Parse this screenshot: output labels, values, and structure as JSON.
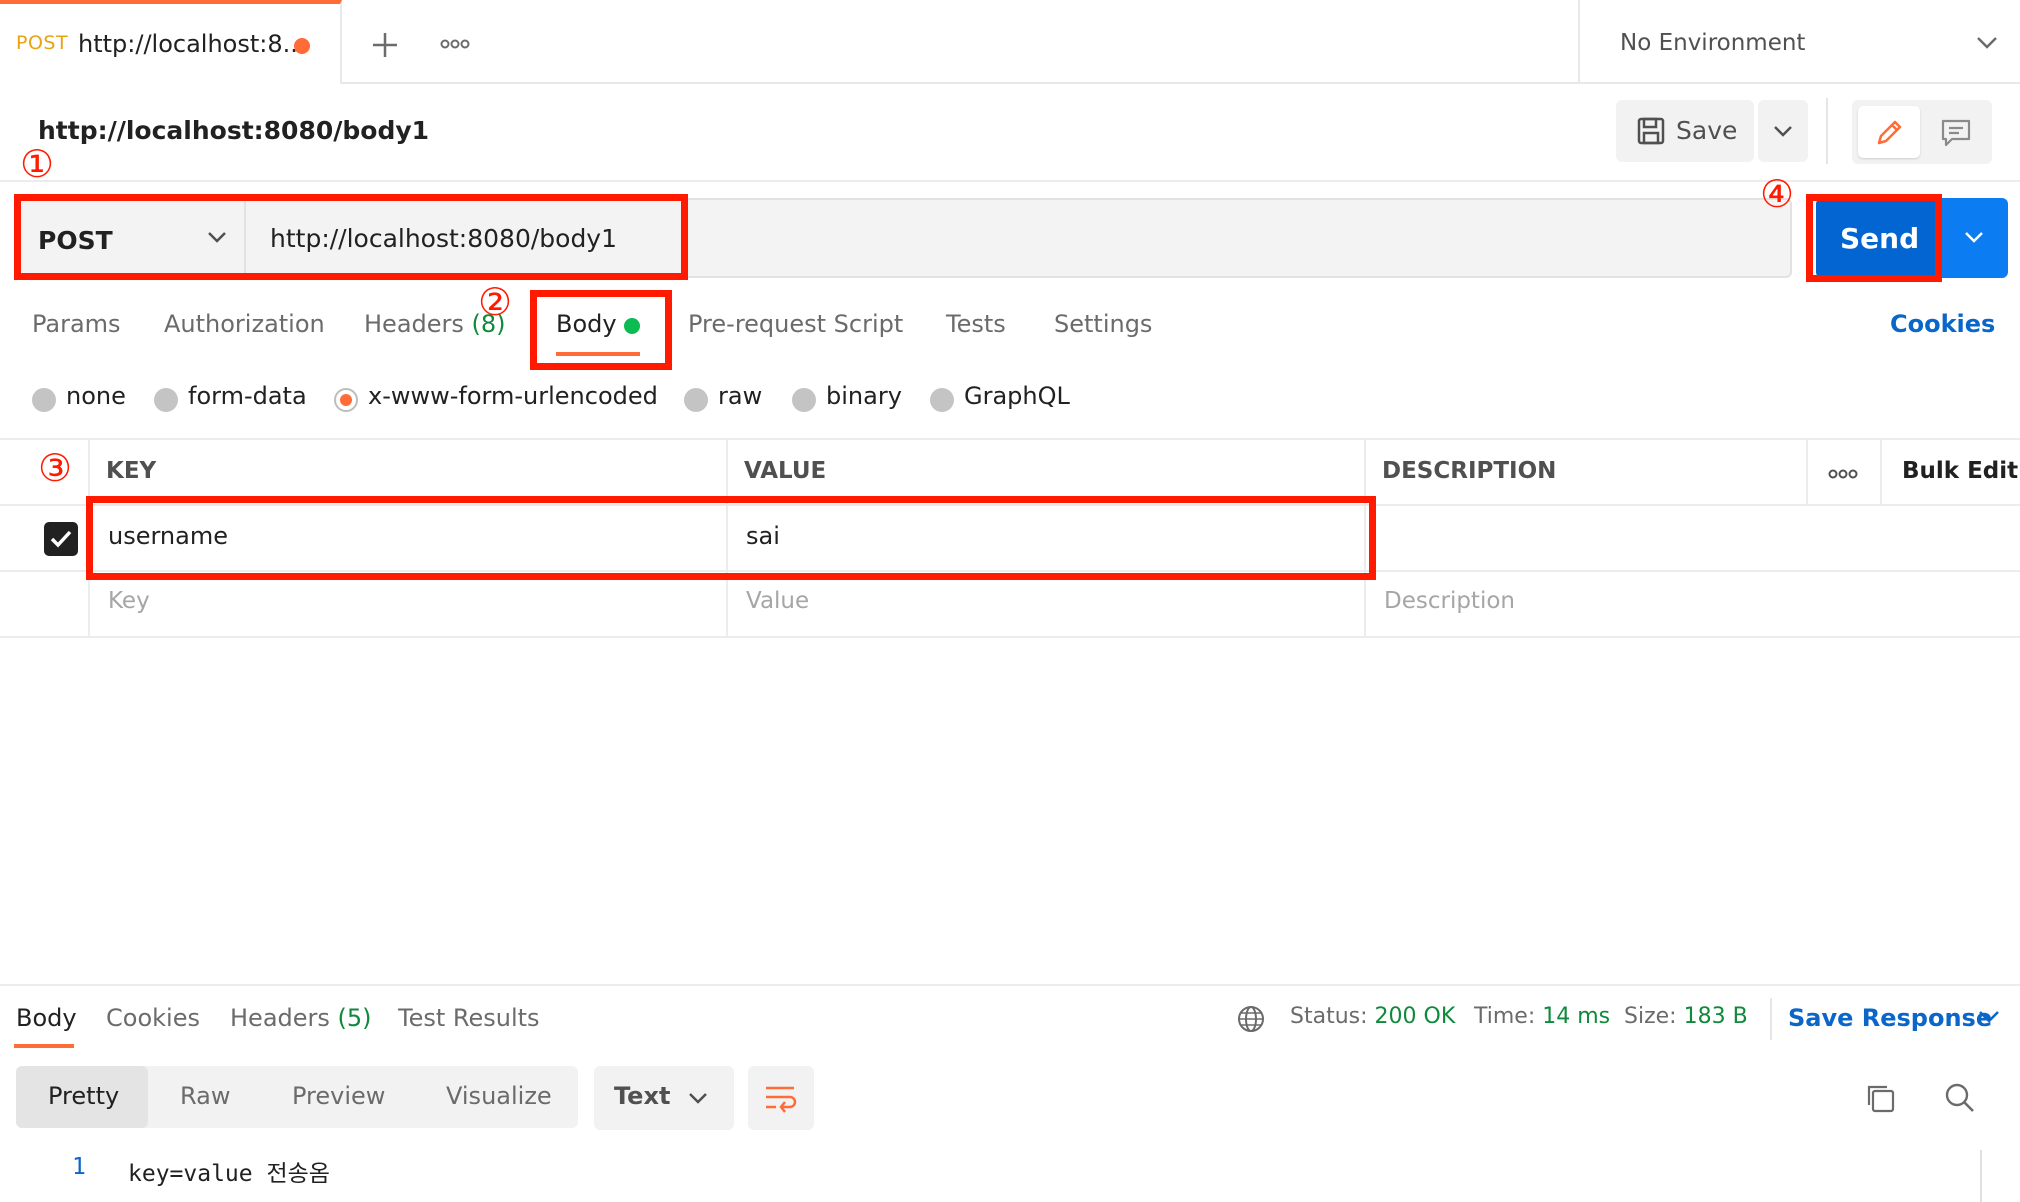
{
  "tab": {
    "method": "POST",
    "title": "http://localhost:8...",
    "new_tab_icon": "plus-icon",
    "more_icon": "more-icon"
  },
  "environment": {
    "label": "No Environment"
  },
  "request": {
    "title": "http://localhost:8080/body1",
    "method": "POST",
    "url": "http://localhost:8080/body1"
  },
  "toolbar": {
    "save_label": "Save",
    "send_label": "Send"
  },
  "request_tabs": {
    "params": "Params",
    "authorization": "Authorization",
    "headers": "Headers",
    "headers_count": "(8)",
    "body": "Body",
    "pre_request": "Pre-request Script",
    "tests": "Tests",
    "settings": "Settings",
    "cookies": "Cookies"
  },
  "body_types": [
    "none",
    "form-data",
    "x-www-form-urlencoded",
    "raw",
    "binary",
    "GraphQL"
  ],
  "body_type_selected": "x-www-form-urlencoded",
  "table": {
    "headers": {
      "key": "KEY",
      "value": "VALUE",
      "description": "DESCRIPTION",
      "bulk_edit": "Bulk Edit"
    },
    "rows": [
      {
        "key": "username",
        "value": "sai",
        "checked": true
      }
    ],
    "placeholders": {
      "key": "Key",
      "value": "Value",
      "description": "Description"
    }
  },
  "annotations": {
    "m1": "①",
    "m2": "②",
    "m3": "③",
    "m4": "④"
  },
  "response": {
    "tabs": {
      "body": "Body",
      "cookies": "Cookies",
      "headers": "Headers",
      "headers_count": "(5)",
      "test_results": "Test Results"
    },
    "status_label": "Status:",
    "status_value": "200 OK",
    "time_label": "Time:",
    "time_value": "14 ms",
    "size_label": "Size:",
    "size_value": "183 B",
    "save_response": "Save Response",
    "views": [
      "Pretty",
      "Raw",
      "Preview",
      "Visualize"
    ],
    "format": "Text",
    "lines": [
      {
        "no": "1",
        "text": "key=value 전송옴"
      }
    ]
  },
  "colors": {
    "accent": "#ff6c37",
    "send": "#0265d2",
    "link": "#0a66c9",
    "success": "#0f8a3c",
    "annotation": "#ff1a00"
  }
}
